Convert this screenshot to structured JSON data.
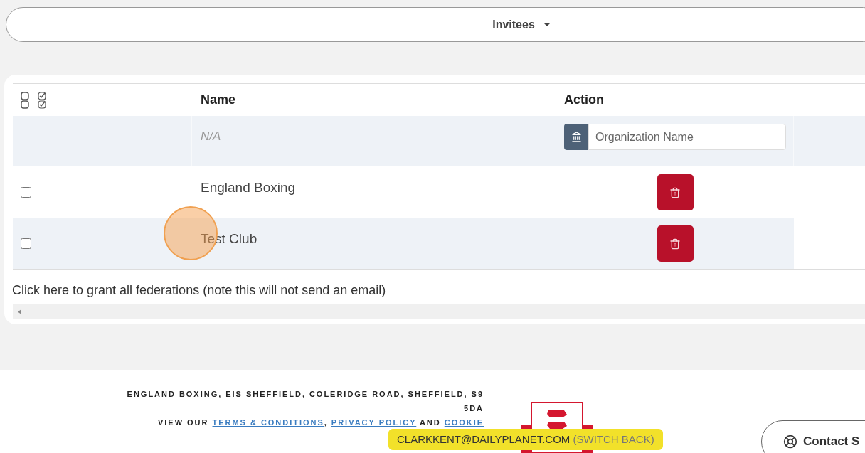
{
  "header": {
    "title": "Invitees"
  },
  "table": {
    "columns": [
      "Name",
      "Action"
    ],
    "filter": {
      "name": "N/A",
      "org_placeholder": "Organization Name"
    },
    "rows": [
      {
        "name": "England Boxing",
        "checked": false
      },
      {
        "name": "Test Club",
        "checked": false
      }
    ]
  },
  "grant_all_link": "Click here to grant all federations (note this will not send an email)",
  "footer": {
    "address": "ENGLAND BOXING, EIS SHEFFIELD, COLERIDGE ROAD, SHEFFIELD, S9 5DA",
    "links_line": [
      {
        "kind": "text",
        "text": "VIEW OUR "
      },
      {
        "kind": "link",
        "text": "TERMS & CONDITIONS"
      },
      {
        "kind": "text",
        "text": ", "
      },
      {
        "kind": "link",
        "text": "PRIVACY POLICY"
      },
      {
        "kind": "text",
        "text": " AND "
      },
      {
        "kind": "link",
        "text": "COOKIE"
      }
    ],
    "impersonation": {
      "email": "CLARKKENT@DAILYPLANET.COM",
      "action": "(SWITCH BACK)"
    },
    "contact": "Contact S"
  }
}
